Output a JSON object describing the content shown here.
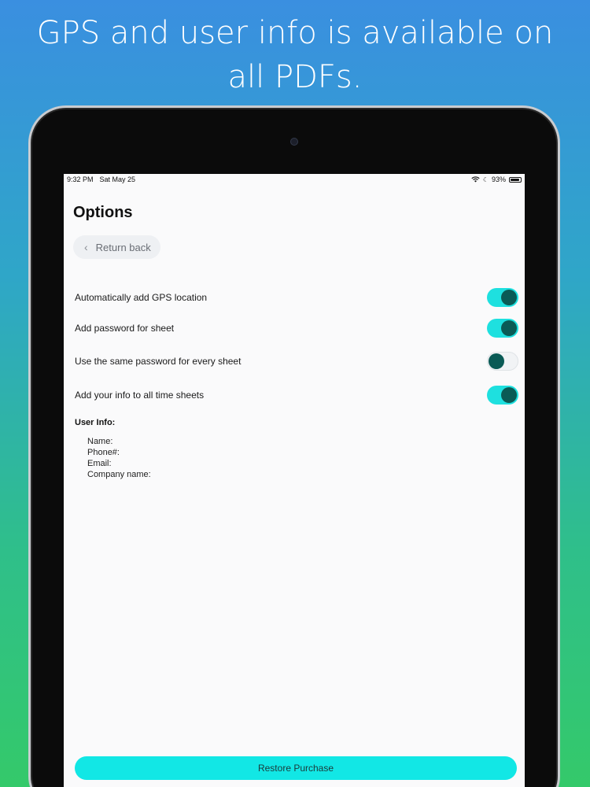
{
  "headline": "GPS and user info is available on all PDFs.",
  "statusbar": {
    "time": "9:32 PM",
    "date": "Sat May 25",
    "battery": "93%",
    "battery_level": 0.93
  },
  "page": {
    "title": "Options",
    "back_label": "Return back"
  },
  "settings": [
    {
      "label": "Automatically add GPS location",
      "on": true
    },
    {
      "label": "Add password for sheet",
      "on": true
    },
    {
      "label": "Use the same password for every sheet",
      "on": false
    },
    {
      "label": "Add your info to all time sheets",
      "on": true
    }
  ],
  "user_info": {
    "label": "User Info:",
    "name": "Name:",
    "phone": "Phone#:",
    "email": "Email:",
    "company": "Company name:"
  },
  "restore_label": "Restore Purchase",
  "colors": {
    "accent": "#1ee0df",
    "knob": "#0a5a55"
  }
}
